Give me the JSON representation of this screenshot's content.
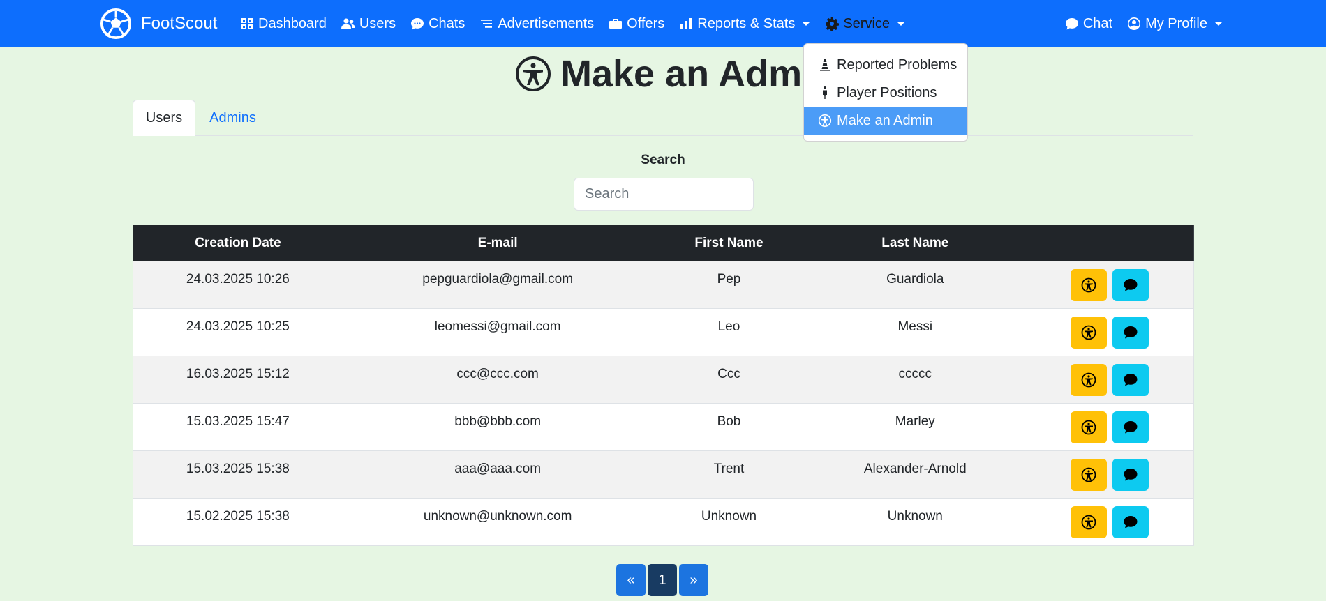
{
  "navbar": {
    "brand": "FootScout",
    "items": [
      {
        "label": "Dashboard",
        "icon": "grid-icon"
      },
      {
        "label": "Users",
        "icon": "people-icon"
      },
      {
        "label": "Chats",
        "icon": "chat-dots-icon"
      },
      {
        "label": "Advertisements",
        "icon": "list-icon"
      },
      {
        "label": "Offers",
        "icon": "briefcase-icon"
      },
      {
        "label": "Reports & Stats",
        "icon": "bar-chart-icon"
      },
      {
        "label": "Service",
        "icon": "gear-icon"
      }
    ],
    "right_items": [
      {
        "label": "Chat",
        "icon": "chat-icon"
      },
      {
        "label": "My Profile",
        "icon": "person-circle-icon"
      }
    ]
  },
  "service_menu": {
    "items": [
      {
        "label": "Reported Problems",
        "icon": "cone-icon"
      },
      {
        "label": "Player Positions",
        "icon": "person-standing-icon"
      },
      {
        "label": "Make an Admin",
        "icon": "universal-access-icon",
        "active": true
      }
    ]
  },
  "page": {
    "title": "Make an Admin"
  },
  "tabs": [
    {
      "label": "Users",
      "active": true
    },
    {
      "label": "Admins",
      "active": false
    }
  ],
  "search": {
    "label": "Search",
    "placeholder": "Search",
    "value": ""
  },
  "table": {
    "headers": [
      "Creation Date",
      "E-mail",
      "First Name",
      "Last Name",
      ""
    ],
    "rows": [
      {
        "date": "24.03.2025 10:26",
        "email": "pepguardiola@gmail.com",
        "first": "Pep",
        "last": "Guardiola"
      },
      {
        "date": "24.03.2025 10:25",
        "email": "leomessi@gmail.com",
        "first": "Leo",
        "last": "Messi"
      },
      {
        "date": "16.03.2025 15:12",
        "email": "ccc@ccc.com",
        "first": "Ccc",
        "last": "ccccc"
      },
      {
        "date": "15.03.2025 15:47",
        "email": "bbb@bbb.com",
        "first": "Bob",
        "last": "Marley"
      },
      {
        "date": "15.03.2025 15:38",
        "email": "aaa@aaa.com",
        "first": "Trent",
        "last": "Alexander-Arnold"
      },
      {
        "date": "15.02.2025 15:38",
        "email": "unknown@unknown.com",
        "first": "Unknown",
        "last": "Unknown"
      }
    ]
  },
  "pagination": {
    "prev": "«",
    "current": "1",
    "next": "»"
  },
  "colors": {
    "navbar": "#0d6efd",
    "page_background": "#e6f6e3",
    "admin_button": "#ffc107",
    "chat_button": "#0dcaf0",
    "table_header": "#212529",
    "dropdown_active": "#4b9cf7"
  }
}
